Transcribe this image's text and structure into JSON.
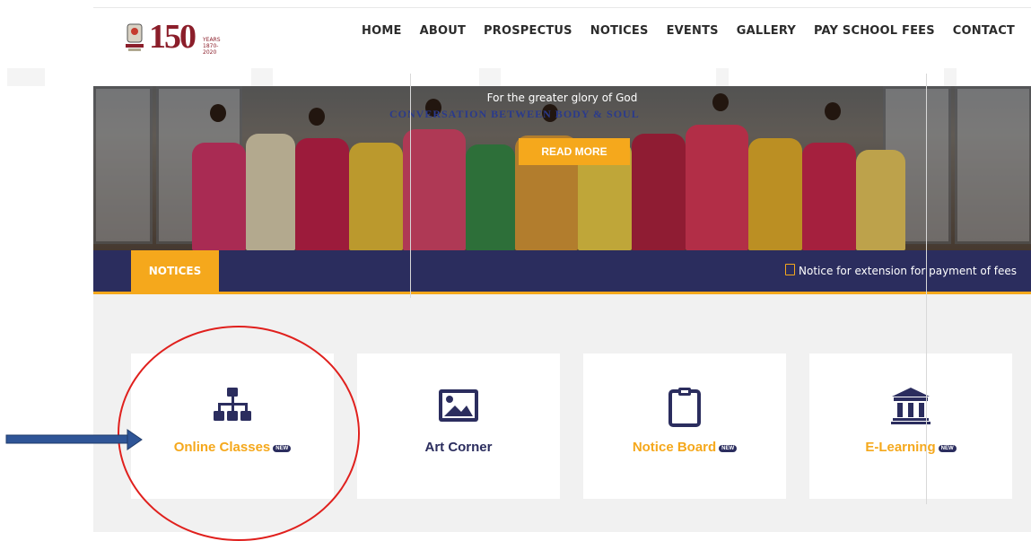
{
  "header": {
    "logo_number": "150",
    "logo_years_text": "YEARS 1870-2020",
    "nav": [
      "HOME",
      "ABOUT",
      "PROSPECTUS",
      "NOTICES",
      "EVENTS",
      "GALLERY",
      "PAY SCHOOL FEES",
      "CONTACT"
    ]
  },
  "hero": {
    "tagline": "For the greater glory of God",
    "banner_text": "CONVERSATION BETWEEN BODY & SOUL",
    "read_more": "READ MORE"
  },
  "notices": {
    "label": "NOTICES",
    "ticker": "Notice for extension for payment of fees"
  },
  "cards": [
    {
      "label": "Online Classes",
      "badge": "NEW",
      "icon": "sitemap-icon",
      "color": "#f5a81c"
    },
    {
      "label": "Art Corner",
      "badge": "",
      "icon": "image-icon",
      "color": "#2b2d5e"
    },
    {
      "label": "Notice Board",
      "badge": "NEW",
      "icon": "clipboard-icon",
      "color": "#f5a81c"
    },
    {
      "label": "E-Learning",
      "badge": "NEW",
      "icon": "institution-icon",
      "color": "#f5a81c"
    }
  ],
  "colors": {
    "accent": "#f5a81c",
    "navy": "#2b2d5e",
    "annotation_red": "#e0201d",
    "annotation_blue": "#2f5597"
  }
}
